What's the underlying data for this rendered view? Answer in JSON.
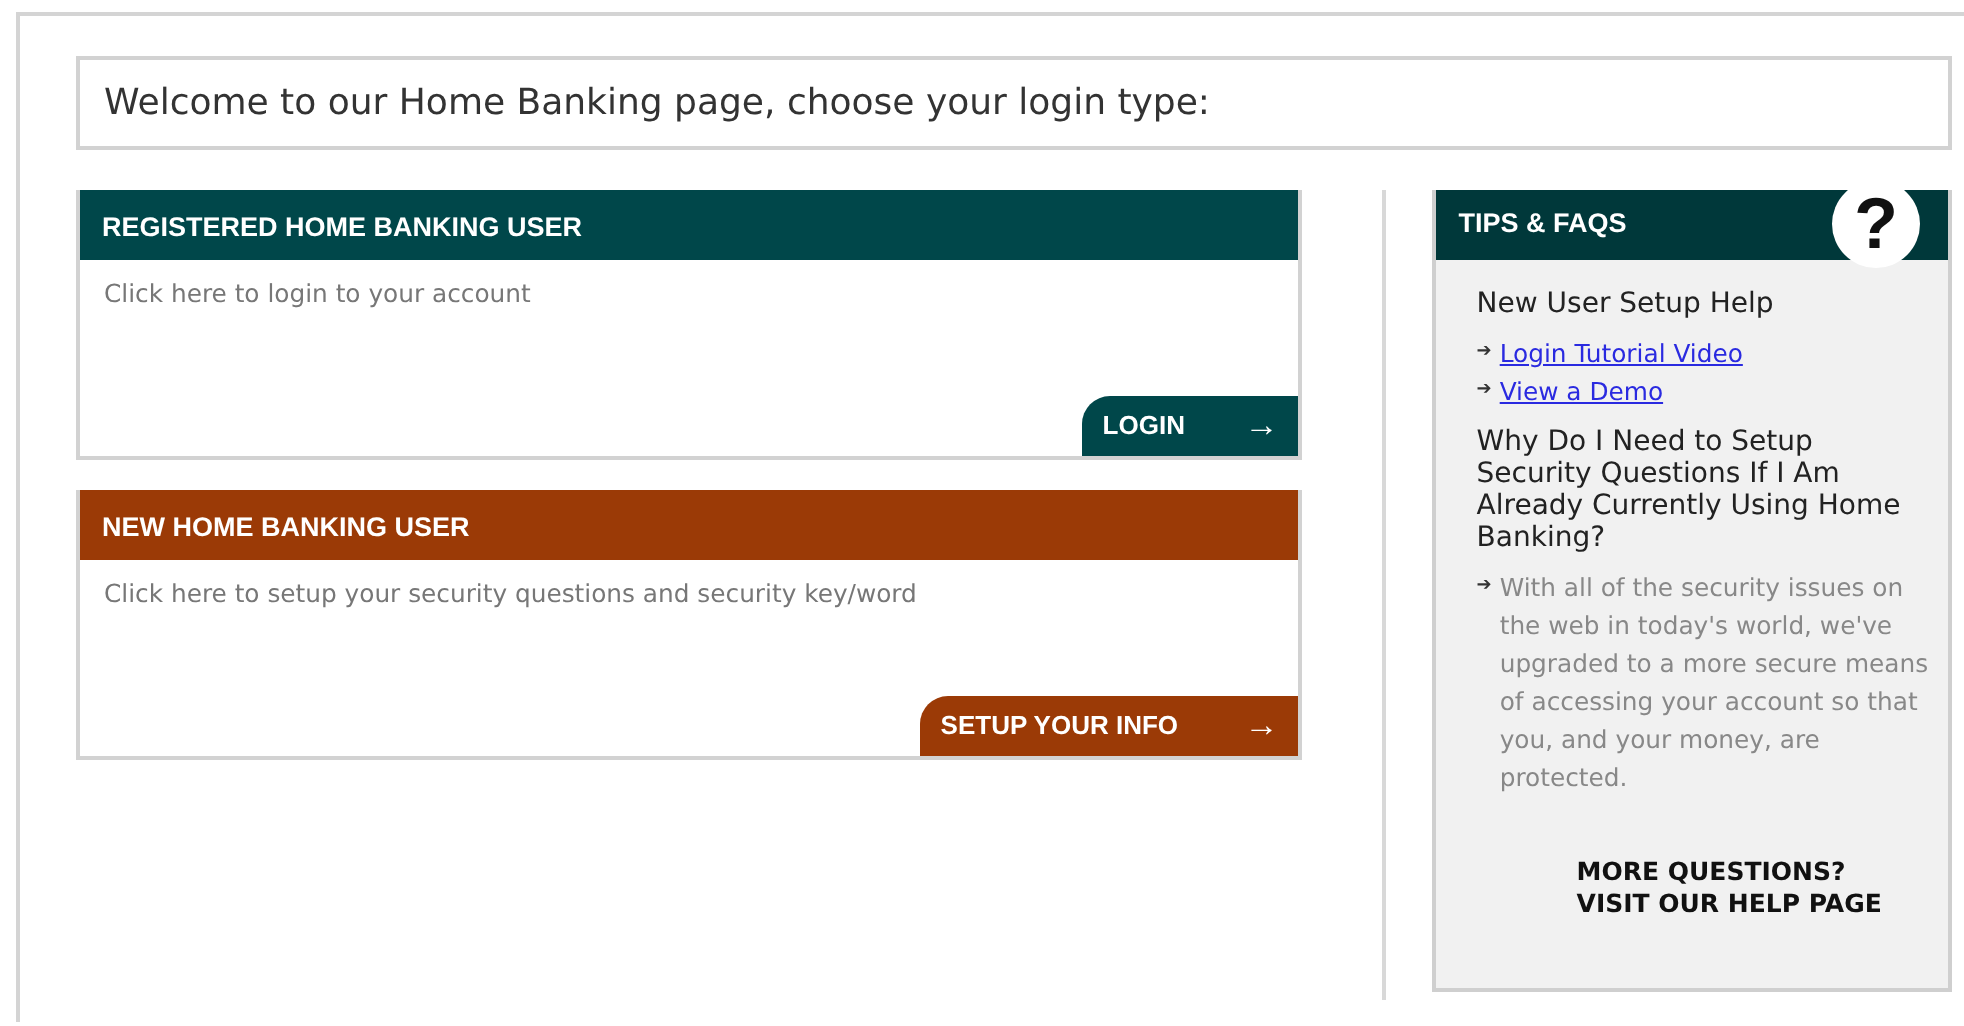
{
  "welcome": "Welcome to our Home Banking page, choose your login type:",
  "panels": [
    {
      "title": "REGISTERED HOME BANKING USER",
      "color": "#00474a",
      "text": "Click here to login to your account",
      "button": "LOGIN",
      "button_arrow": "→"
    },
    {
      "title": "NEW HOME BANKING USER",
      "color": "#9b3a06",
      "text": "Click here to setup your security questions and security key/word",
      "button": "SETUP YOUR INFO",
      "button_arrow": "→"
    }
  ],
  "tips": {
    "title": "TIPS & FAQS",
    "help_glyph": "?",
    "sections": [
      {
        "kind": "links",
        "heading": "New User Setup Help",
        "items": [
          {
            "arrow": "➔",
            "text": "Login Tutorial Video"
          },
          {
            "arrow": "➔",
            "text": "View a Demo"
          }
        ]
      },
      {
        "kind": "answer",
        "heading": "Why Do I Need to Setup Security Questions If I Am Already Currently Using Home Banking?",
        "items": [
          {
            "arrow": "➔",
            "text": "With all of the security issues on the web in today's world, we've upgraded to a more secure means of accessing your account so that you, and your money, are protected."
          }
        ]
      }
    ],
    "footer": [
      "MORE QUESTIONS?",
      "VISIT OUR HELP PAGE"
    ]
  }
}
